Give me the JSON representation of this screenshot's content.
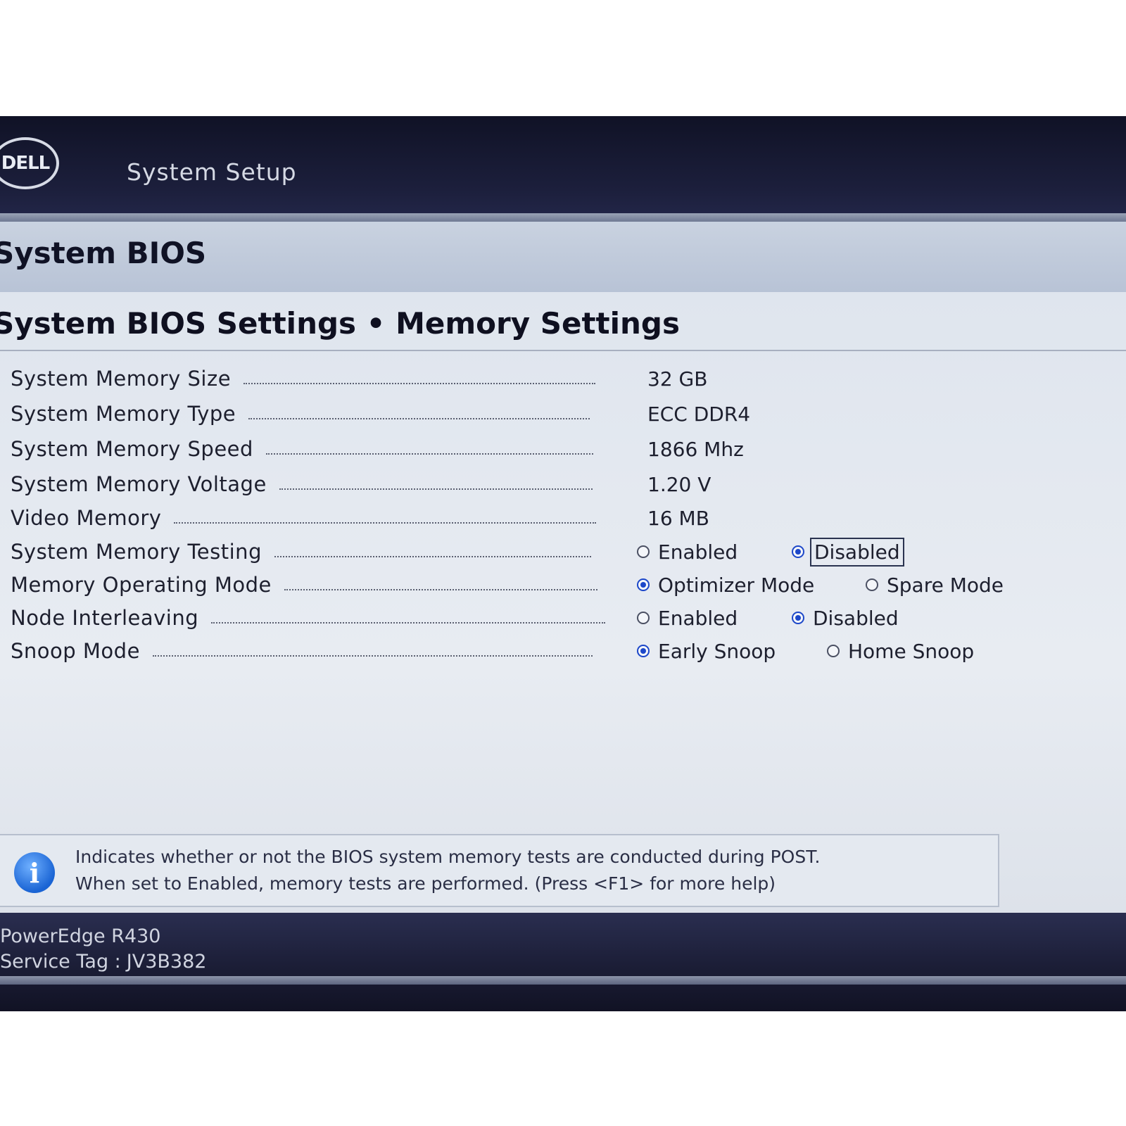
{
  "header": {
    "logo_text": "DELL",
    "app_title": "System Setup"
  },
  "section": {
    "title": "System BIOS"
  },
  "page": {
    "title": "System BIOS Settings • Memory Settings"
  },
  "settings": [
    {
      "label": "System Memory Size",
      "value": "32 GB"
    },
    {
      "label": "System Memory Type",
      "value": "ECC DDR4"
    },
    {
      "label": "System Memory Speed",
      "value": "1866 Mhz"
    },
    {
      "label": "System Memory Voltage",
      "value": "1.20 V"
    },
    {
      "label": "Video Memory",
      "value": "16 MB"
    },
    {
      "label": "System Memory Testing",
      "options": [
        "Enabled",
        "Disabled"
      ],
      "selected": "Disabled"
    },
    {
      "label": "Memory Operating Mode",
      "options": [
        "Optimizer Mode",
        "Spare Mode"
      ],
      "selected": "Optimizer Mode"
    },
    {
      "label": "Node Interleaving",
      "options": [
        "Enabled",
        "Disabled"
      ],
      "selected": "Disabled"
    },
    {
      "label": "Snoop Mode",
      "options": [
        "Early Snoop",
        "Home Snoop"
      ],
      "selected": "Early Snoop"
    }
  ],
  "help": {
    "text_line1": "Indicates whether or not the BIOS system memory tests are conducted during POST.",
    "text_line2": "When set to Enabled, memory tests are performed. (Press <F1> for more help)"
  },
  "footer": {
    "model": "PowerEdge R430",
    "service_tag_label": "Service Tag :",
    "service_tag_value": "JV3B382"
  },
  "colors": {
    "radio_selected": "#1c47c9",
    "header_bg": "#1c1f3c",
    "panel_bg": "#e4e9f0"
  }
}
